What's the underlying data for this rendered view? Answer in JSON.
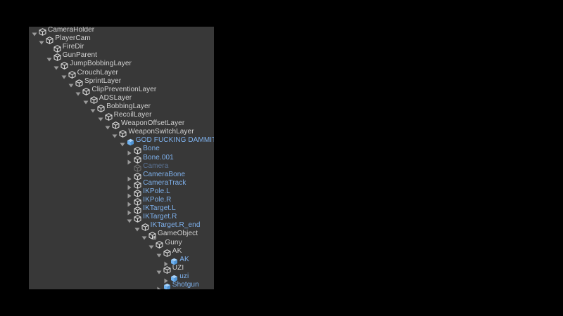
{
  "hierarchy": {
    "items": [
      {
        "label": "CameraHolder",
        "depth": 0,
        "expanded": true,
        "has_children": true,
        "kind": "gameobject"
      },
      {
        "label": "PlayerCam",
        "depth": 1,
        "expanded": true,
        "has_children": true,
        "kind": "gameobject"
      },
      {
        "label": "FireDir",
        "depth": 2,
        "expanded": false,
        "has_children": false,
        "kind": "gameobject"
      },
      {
        "label": "GunParent",
        "depth": 2,
        "expanded": true,
        "has_children": true,
        "kind": "gameobject"
      },
      {
        "label": "JumpBobbingLayer",
        "depth": 3,
        "expanded": true,
        "has_children": true,
        "kind": "gameobject"
      },
      {
        "label": "CrouchLayer",
        "depth": 4,
        "expanded": true,
        "has_children": true,
        "kind": "gameobject"
      },
      {
        "label": "SprintLayer",
        "depth": 5,
        "expanded": true,
        "has_children": true,
        "kind": "gameobject"
      },
      {
        "label": "ClipPreventionLayer",
        "depth": 6,
        "expanded": true,
        "has_children": true,
        "kind": "gameobject"
      },
      {
        "label": "ADSLayer",
        "depth": 7,
        "expanded": true,
        "has_children": true,
        "kind": "gameobject"
      },
      {
        "label": "BobbingLayer",
        "depth": 8,
        "expanded": true,
        "has_children": true,
        "kind": "gameobject"
      },
      {
        "label": "RecoilLayer",
        "depth": 9,
        "expanded": true,
        "has_children": true,
        "kind": "gameobject"
      },
      {
        "label": "WeaponOffsetLayer",
        "depth": 10,
        "expanded": true,
        "has_children": true,
        "kind": "gameobject"
      },
      {
        "label": "WeaponSwitchLayer",
        "depth": 11,
        "expanded": true,
        "has_children": true,
        "kind": "gameobject"
      },
      {
        "label": "GOD FUCKING DAMMIT",
        "depth": 12,
        "expanded": true,
        "has_children": true,
        "kind": "prefab"
      },
      {
        "label": "Bone",
        "depth": 13,
        "expanded": false,
        "has_children": true,
        "kind": "prefab-child"
      },
      {
        "label": "Bone.001",
        "depth": 13,
        "expanded": false,
        "has_children": true,
        "kind": "prefab-child"
      },
      {
        "label": "Camera",
        "depth": 13,
        "expanded": false,
        "has_children": false,
        "kind": "prefab-child-disabled"
      },
      {
        "label": "CameraBone",
        "depth": 13,
        "expanded": false,
        "has_children": true,
        "kind": "prefab-child"
      },
      {
        "label": "CameraTrack",
        "depth": 13,
        "expanded": false,
        "has_children": true,
        "kind": "prefab-child"
      },
      {
        "label": "IKPole.L",
        "depth": 13,
        "expanded": false,
        "has_children": true,
        "kind": "prefab-child"
      },
      {
        "label": "IKPole.R",
        "depth": 13,
        "expanded": false,
        "has_children": true,
        "kind": "prefab-child"
      },
      {
        "label": "IKTarget.L",
        "depth": 13,
        "expanded": false,
        "has_children": true,
        "kind": "prefab-child"
      },
      {
        "label": "IKTarget.R",
        "depth": 13,
        "expanded": true,
        "has_children": true,
        "kind": "prefab-child"
      },
      {
        "label": "IKTarget.R_end",
        "depth": 14,
        "expanded": true,
        "has_children": true,
        "kind": "prefab-child"
      },
      {
        "label": "GameObject",
        "depth": 15,
        "expanded": true,
        "has_children": true,
        "kind": "gameobject-added"
      },
      {
        "label": "Guny",
        "depth": 16,
        "expanded": true,
        "has_children": true,
        "kind": "gameobject"
      },
      {
        "label": "AK",
        "depth": 17,
        "expanded": true,
        "has_children": true,
        "kind": "gameobject"
      },
      {
        "label": "AK",
        "depth": 18,
        "expanded": false,
        "has_children": true,
        "kind": "prefab"
      },
      {
        "label": "UZI",
        "depth": 17,
        "expanded": true,
        "has_children": true,
        "kind": "gameobject"
      },
      {
        "label": "uzi",
        "depth": 18,
        "expanded": false,
        "has_children": true,
        "kind": "prefab"
      },
      {
        "label": "Shotgun",
        "depth": 17,
        "expanded": false,
        "has_children": true,
        "kind": "prefab"
      }
    ]
  },
  "colors": {
    "panel_background": "#383838",
    "label_normal": "#d2d2d2",
    "label_prefab": "#7fb2ee",
    "label_prefab_disabled": "#5b7496",
    "arrow": "#9a9a9a",
    "icon_outline": "#d6d6d6",
    "prefab_icon_fill": "#6fb3f2"
  },
  "icons": {
    "gameobject": "cube-outline-icon",
    "prefab": "prefab-cube-icon",
    "expanded": "triangle-down-icon",
    "collapsed": "triangle-right-icon"
  }
}
